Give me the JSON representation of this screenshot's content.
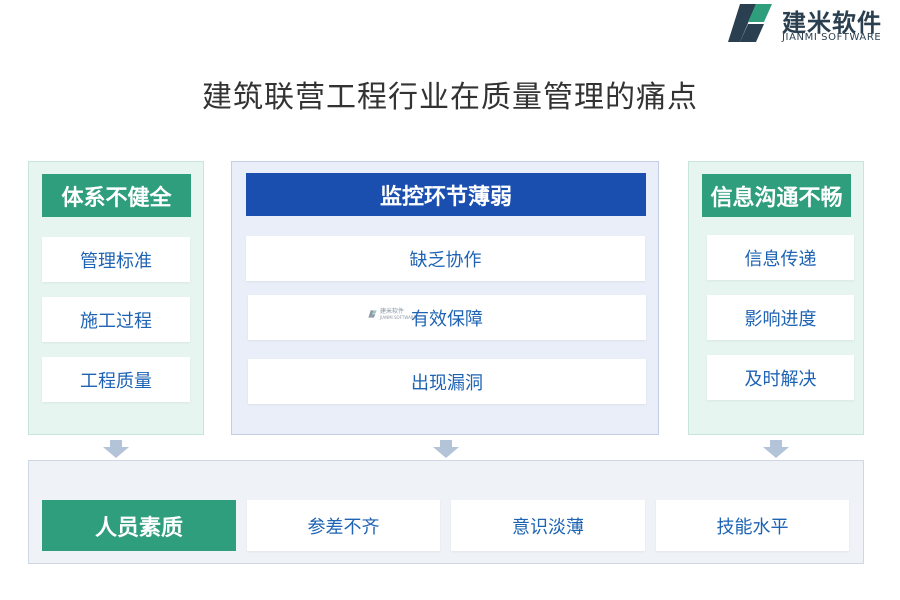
{
  "logo": {
    "cn": "建米软件",
    "en": "JIANMI SOFTWARE"
  },
  "title": "建筑联营工程行业在质量管理的痛点",
  "left": {
    "heading": "体系不健全",
    "items": [
      "管理标准",
      "施工过程",
      "工程质量"
    ]
  },
  "center": {
    "heading": "监控环节薄弱",
    "items": [
      "缺乏协作",
      "有效保障",
      "出现漏洞"
    ]
  },
  "right": {
    "heading": "信息沟通不畅",
    "items": [
      "信息传递",
      "影响进度",
      "及时解决"
    ]
  },
  "bottom": {
    "heading": "人员素质",
    "items": [
      "参差不齐",
      "意识淡薄",
      "技能水平"
    ]
  },
  "watermark": {
    "cn": "建米软件",
    "en": "JIANMI SOFTWARE"
  },
  "colors": {
    "green": "#2e9e7c",
    "blue": "#1b4faf",
    "item_text": "#1e63b4",
    "arrow": "#b3c3d8"
  }
}
